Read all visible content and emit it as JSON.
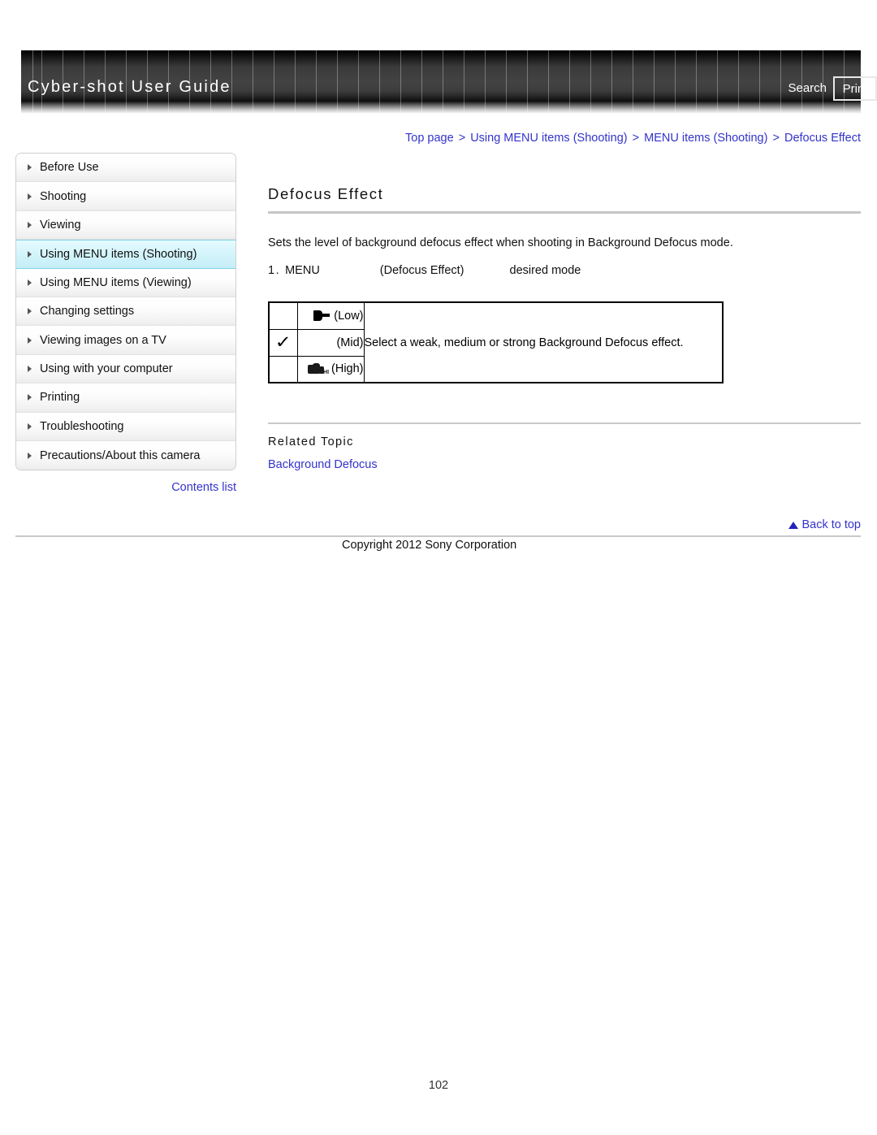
{
  "header": {
    "title": "Cyber-shot User Guide",
    "search_label": "Search",
    "print_label": "Print"
  },
  "breadcrumb": {
    "separator": ">",
    "items": [
      "Top page",
      "Using MENU items (Shooting)",
      "MENU items (Shooting)",
      "Defocus Effect"
    ]
  },
  "sidebar": {
    "items": [
      {
        "label": "Before Use",
        "active": false
      },
      {
        "label": "Shooting",
        "active": false
      },
      {
        "label": "Viewing",
        "active": false
      },
      {
        "label": "Using MENU items (Shooting)",
        "active": true
      },
      {
        "label": "Using MENU items (Viewing)",
        "active": false
      },
      {
        "label": "Changing settings",
        "active": false
      },
      {
        "label": "Viewing images on a TV",
        "active": false
      },
      {
        "label": "Using with your computer",
        "active": false
      },
      {
        "label": "Printing",
        "active": false
      },
      {
        "label": "Troubleshooting",
        "active": false
      },
      {
        "label": "Precautions/About this camera",
        "active": false
      }
    ],
    "contents_list_label": "Contents list"
  },
  "main": {
    "page_title": "Defocus Effect",
    "intro": "Sets the level of background defocus effect when shooting in Background Defocus mode.",
    "step": {
      "number": "1.",
      "menu_label": "MENU",
      "setting_label": "(Defocus Effect)",
      "result_label": "desired mode"
    },
    "options_table": {
      "rows": [
        {
          "selected": false,
          "icon": "defocus-low-icon",
          "label": "(Low)"
        },
        {
          "selected": true,
          "icon": "",
          "label": "(Mid)"
        },
        {
          "selected": false,
          "icon": "defocus-high-icon",
          "label": "(High)"
        }
      ],
      "description": "Select a weak, medium or strong Background Defocus effect.",
      "check_glyph": "✓"
    },
    "related_topic": {
      "heading": "Related Topic",
      "link_label": "Background Defocus"
    }
  },
  "footer": {
    "back_to_top_label": "Back to top",
    "copyright": "Copyright 2012 Sony Corporation",
    "page_number": "102"
  },
  "colors": {
    "link": "#3333cc",
    "active_nav": "#c6eef8",
    "banner_dark": "#434343"
  }
}
